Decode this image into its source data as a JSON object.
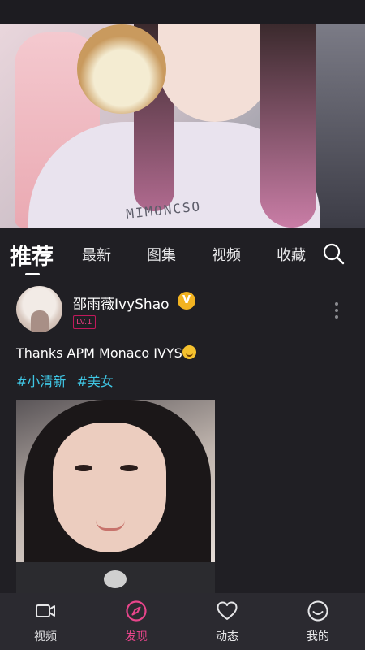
{
  "tabs": [
    {
      "label": "推荐",
      "active": true
    },
    {
      "label": "最新"
    },
    {
      "label": "图集"
    },
    {
      "label": "视频"
    },
    {
      "label": "收藏"
    }
  ],
  "hero": {
    "shirt_text": "MIMONCSO"
  },
  "post": {
    "username": "邵雨薇IvyShao",
    "verified_badge": "V",
    "level": "LV.1",
    "caption": "Thanks APM Monaco IVYS",
    "hashtags": [
      "#小清新",
      "#美女"
    ]
  },
  "bottom_nav": [
    {
      "label": "视频",
      "icon": "video-icon"
    },
    {
      "label": "发现",
      "icon": "compass-icon",
      "active": true
    },
    {
      "label": "动态",
      "icon": "heart-icon"
    },
    {
      "label": "我的",
      "icon": "smile-icon"
    }
  ],
  "colors": {
    "background": "#201f24",
    "accent_pink": "#e8458b",
    "hashtag_cyan": "#3fc6e4",
    "verified_gold": "#f2b321"
  }
}
